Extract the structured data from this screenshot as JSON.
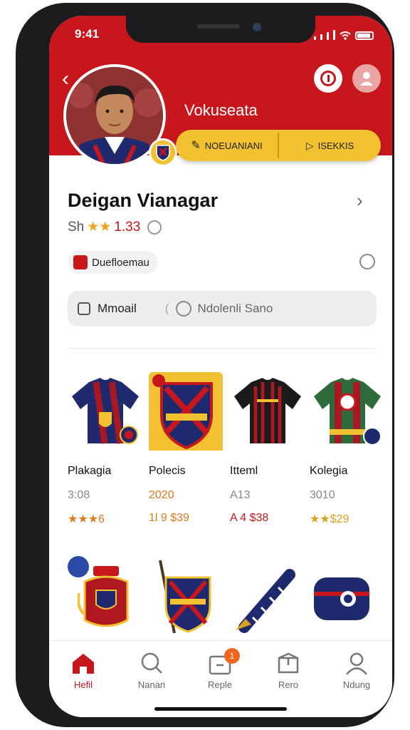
{
  "status_bar": {
    "time": "9:41"
  },
  "profile": {
    "header_title": "Vokuseata",
    "action_left_label": "NOEUANIANI",
    "action_right_label": "ISEKKIS",
    "name": "Deigan Vianagar",
    "rating_prefix": "Sh",
    "rating_value": "1.33",
    "tag_label": "Duefloemau"
  },
  "search": {
    "left_label": "Mmoail",
    "placeholder": "Ndolenli Sano"
  },
  "products": [
    {
      "name": "Plakagia",
      "sales": "3:08",
      "price": "★★★6"
    },
    {
      "name": "Polecis",
      "sales": "2020",
      "price": "1l 9 $39"
    },
    {
      "name": "Itteml",
      "sales": "A13",
      "price": "A 4 $38"
    },
    {
      "name": "Kolegia",
      "sales": "3010",
      "price": "★★$29"
    }
  ],
  "nav": [
    {
      "label": "Hefil",
      "icon": "home-icon",
      "active": true
    },
    {
      "label": "Nanan",
      "icon": "search-icon"
    },
    {
      "label": "Reple",
      "icon": "cart-icon",
      "badge": "1"
    },
    {
      "label": "Rero",
      "icon": "box-icon"
    },
    {
      "label": "Ndung",
      "icon": "user-icon"
    }
  ],
  "colors": {
    "brand_red": "#c8161d",
    "accent_yellow": "#f2c130",
    "price_orange": "#e07a1f"
  }
}
